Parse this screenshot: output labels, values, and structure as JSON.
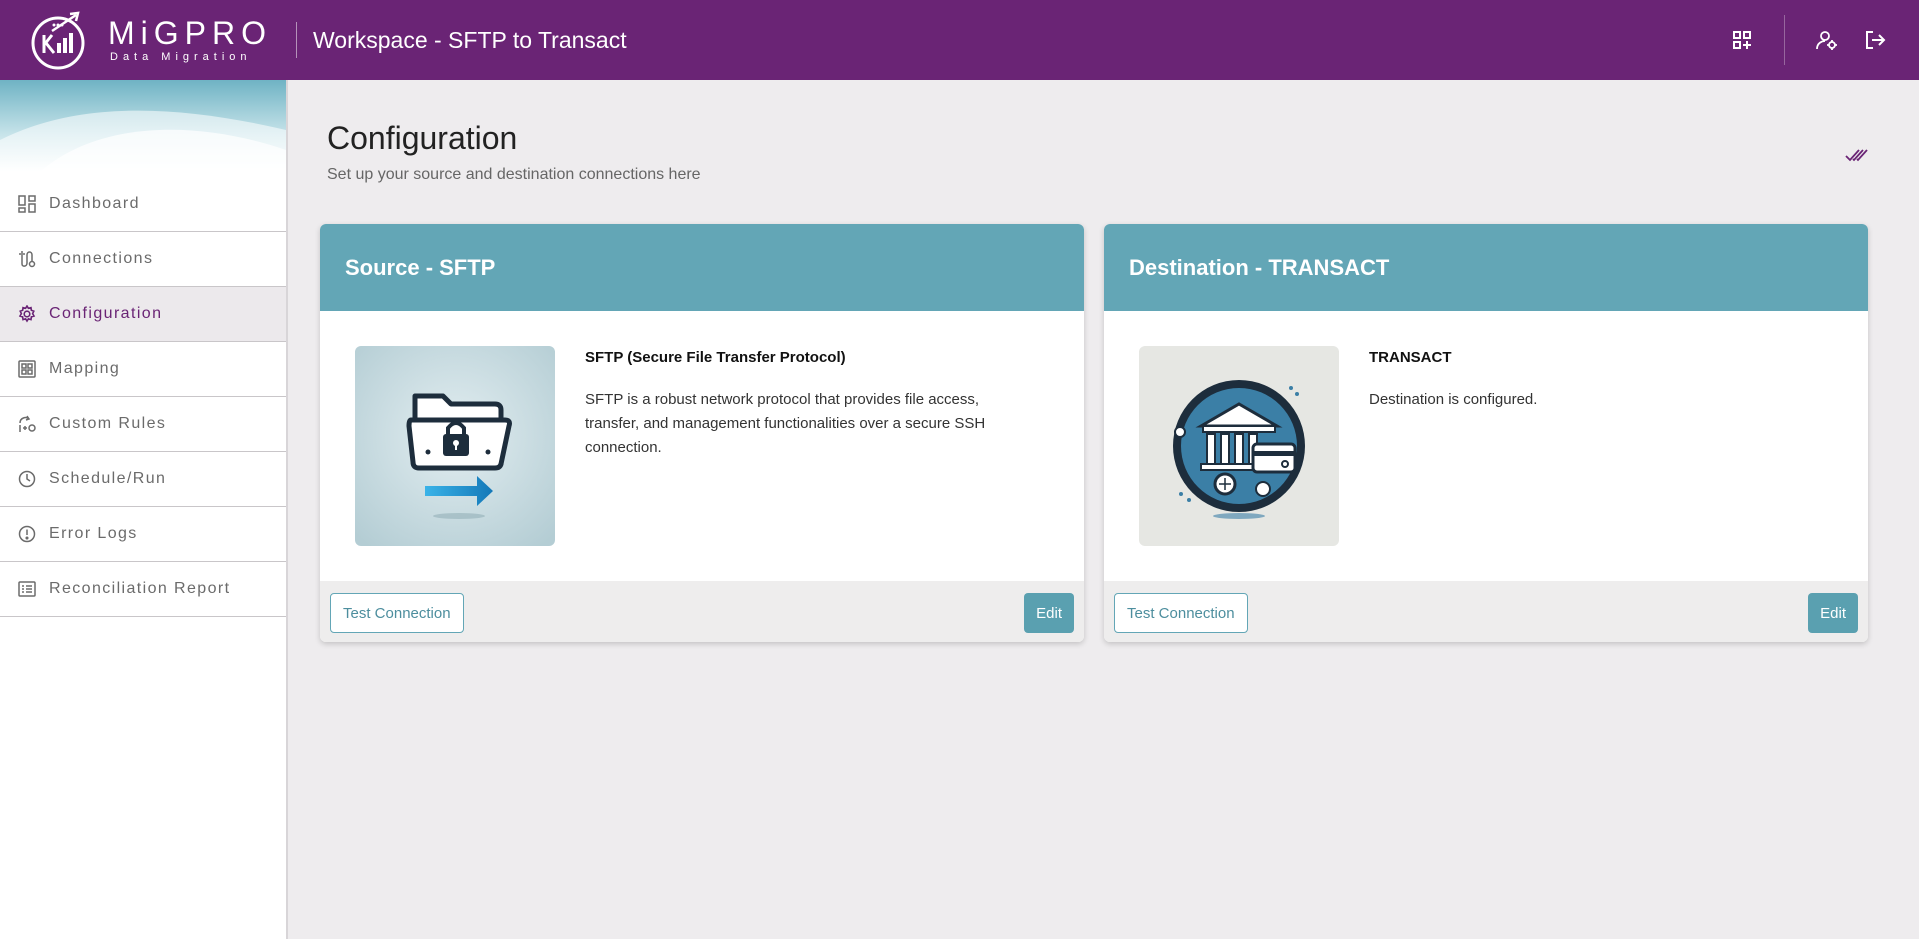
{
  "header": {
    "logo_name": "MiGPRO",
    "logo_sub": "Data Migration",
    "workspace_title": "Workspace - SFTP to Transact",
    "icons": [
      "apps-add-icon",
      "user-settings-icon",
      "logout-icon"
    ],
    "color": "#6a2475"
  },
  "sidebar": {
    "items": [
      {
        "label": "Dashboard",
        "icon": "dashboard-icon",
        "active": false
      },
      {
        "label": "Connections",
        "icon": "connections-icon",
        "active": false
      },
      {
        "label": "Configuration",
        "icon": "gear-icon",
        "active": true
      },
      {
        "label": "Mapping",
        "icon": "grid-icon",
        "active": false
      },
      {
        "label": "Custom Rules",
        "icon": "rules-icon",
        "active": false
      },
      {
        "label": "Schedule/Run",
        "icon": "clock-icon",
        "active": false
      },
      {
        "label": "Error Logs",
        "icon": "alert-icon",
        "active": false
      },
      {
        "label": "Reconciliation Report",
        "icon": "report-icon",
        "active": false
      }
    ]
  },
  "main": {
    "title": "Configuration",
    "subtitle": "Set up your source and destination connections here",
    "status_icon": "double-check-icon",
    "cards": [
      {
        "title": "Source - SFTP",
        "info_title": "SFTP (Secure File Transfer Protocol)",
        "info_desc": "SFTP is a robust network protocol that provides file access, transfer, and management functionalities over a secure SSH connection.",
        "image_icon": "secure-folder-icon",
        "test_label": "Test Connection",
        "edit_label": "Edit"
      },
      {
        "title": "Destination - TRANSACT",
        "info_title": "TRANSACT",
        "info_desc": "Destination is configured.",
        "image_icon": "bank-icon",
        "test_label": "Test Connection",
        "edit_label": "Edit"
      }
    ],
    "accent_color": "#63a6b6"
  }
}
